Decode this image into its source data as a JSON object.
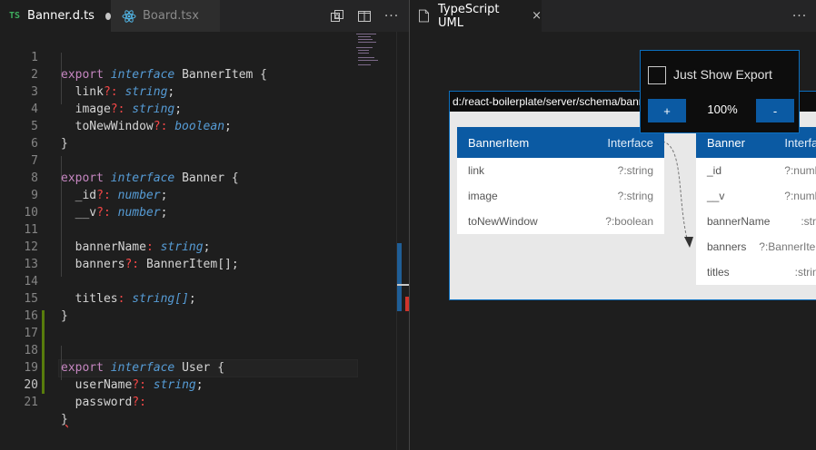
{
  "left_tabs": [
    {
      "badge": "TS",
      "label": "Banner.d.ts",
      "active": true,
      "dirty": true
    },
    {
      "label": "Board.tsx",
      "active": false
    }
  ],
  "right_tabs": [
    {
      "label": "TypeScript UML",
      "close": "×"
    }
  ],
  "more_actions": "···",
  "code_lines": [
    {
      "num": "1"
    },
    {
      "num": "2"
    },
    {
      "num": "3"
    },
    {
      "num": "4"
    },
    {
      "num": "5"
    },
    {
      "num": "6"
    },
    {
      "num": "7"
    },
    {
      "num": "8"
    },
    {
      "num": "9"
    },
    {
      "num": "10"
    },
    {
      "num": "11"
    },
    {
      "num": "12"
    },
    {
      "num": "13"
    },
    {
      "num": "14"
    },
    {
      "num": "15"
    },
    {
      "num": "16"
    },
    {
      "num": "17"
    },
    {
      "num": "18"
    },
    {
      "num": "19"
    },
    {
      "num": "20"
    },
    {
      "num": "21"
    }
  ],
  "tokens": {
    "export": "export",
    "interface": "interface",
    "open_brace": " {",
    "close_brace": "}",
    "i1_name": "BannerItem",
    "link": "link",
    "image": "image",
    "toNewWindow": "toNewWindow",
    "opt": "?:",
    "colon": ":",
    "semi": ";",
    "string": "string",
    "boolean": "boolean",
    "number": "number",
    "i2_name": "Banner",
    "_id": "_id",
    "__v": "__v",
    "bannerName": "bannerName",
    "banners": "banners",
    "BannerItemArr": "BannerItem[]",
    "titles": "titles",
    "stringArr": "string[]",
    "i3_name": "User",
    "userName": "userName",
    "password": "password"
  },
  "uml": {
    "path": "d:/react-boilerplate/server/schema/banner.d.ts",
    "cards": [
      {
        "title": "BannerItem",
        "kind": "Interface",
        "rows": [
          {
            "name": "link",
            "type": "?:string"
          },
          {
            "name": "image",
            "type": "?:string"
          },
          {
            "name": "toNewWindow",
            "type": "?:boolean"
          }
        ]
      },
      {
        "title": "Banner",
        "kind": "Interface",
        "rows": [
          {
            "name": "_id",
            "type": "?:number"
          },
          {
            "name": "__v",
            "type": "?:number"
          },
          {
            "name": "bannerName",
            "type": ":string"
          },
          {
            "name": "banners",
            "type": "?:BannerItem[]"
          },
          {
            "name": "titles",
            "type": ":string[]"
          }
        ]
      }
    ]
  },
  "controls": {
    "show_export_label": "Just Show Export",
    "show_export_checked": false,
    "zoom_in": "+",
    "zoom_out": "-",
    "zoom_level": "100%"
  },
  "colors": {
    "keyword": "#c586c0",
    "type": "#569cd6",
    "optional": "#f44747",
    "uml_header": "#0b5aa3",
    "git_added": "#587c0c"
  }
}
